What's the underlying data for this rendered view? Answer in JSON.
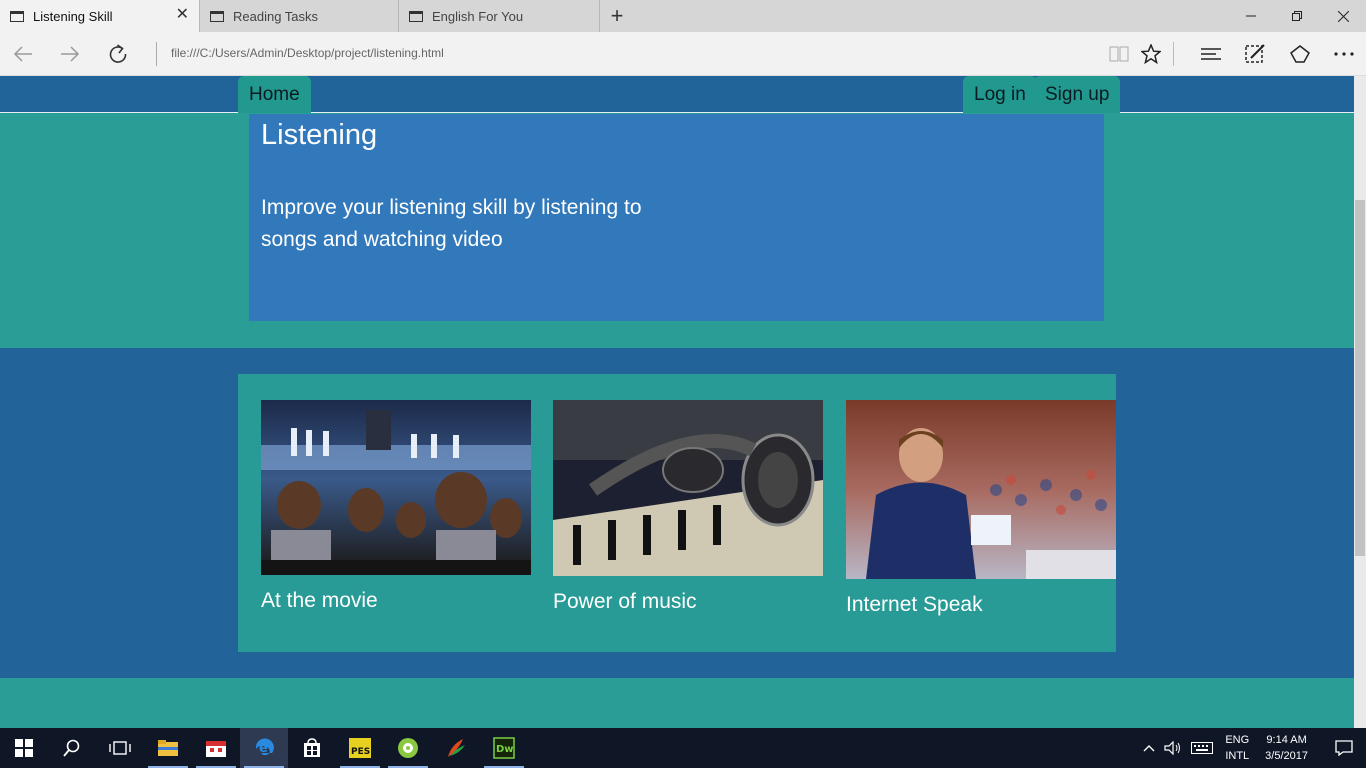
{
  "browser": {
    "tabs": [
      {
        "title": "Listening Skill",
        "active": true
      },
      {
        "title": "Reading Tasks",
        "active": false
      },
      {
        "title": "English For You",
        "active": false
      }
    ],
    "address": "file:///C:/Users/Admin/Desktop/project/listening.html"
  },
  "site": {
    "nav": {
      "home": "Home",
      "login": "Log in",
      "signup": "Sign up"
    },
    "hero": {
      "title": "Listening",
      "subtitle": "Improve your listening skill by listening to songs and watching video"
    },
    "cards": [
      {
        "caption": "At the movie",
        "image": "theater-audience-photo"
      },
      {
        "caption": "Power of music",
        "image": "headphones-on-piano-photo"
      },
      {
        "caption": "Internet Speak",
        "image": "conference-speaker-photo"
      }
    ],
    "colors": {
      "header": "#20649a",
      "teal": "#2a9d96",
      "hero": "#3279bc",
      "cards_band": "#22639a"
    }
  },
  "taskbar": {
    "language": "ENG",
    "layout": "INTL",
    "time": "9:14 AM",
    "date": "3/5/2017"
  }
}
